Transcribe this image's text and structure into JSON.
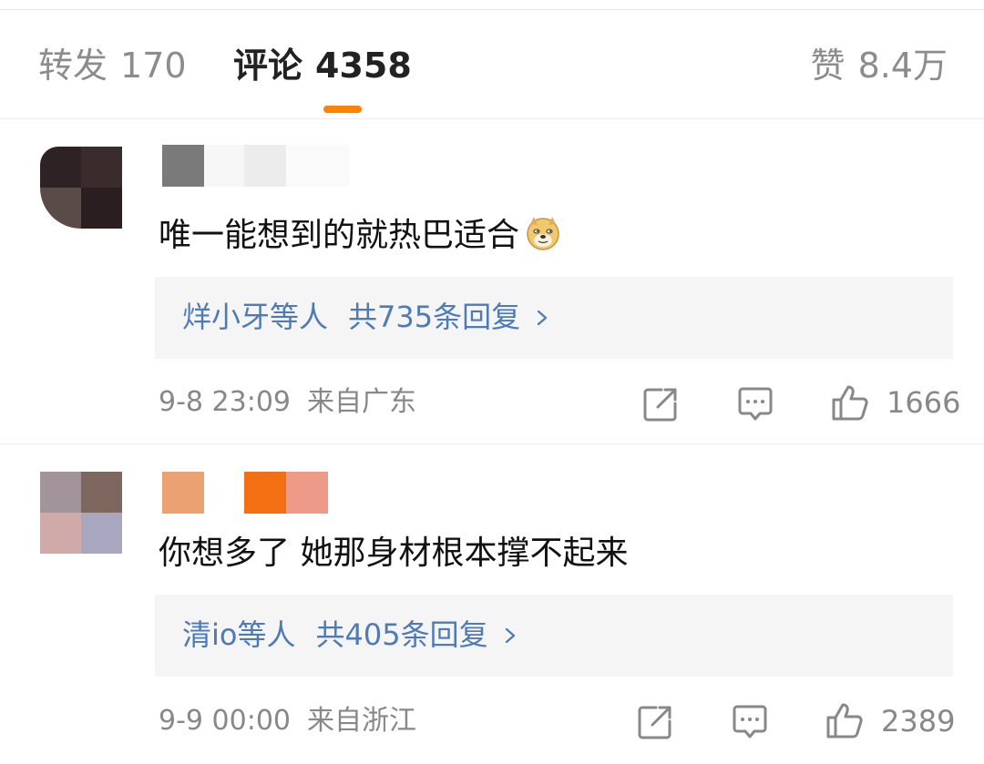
{
  "tabs": {
    "repost": {
      "label": "转发",
      "count": "170"
    },
    "comments": {
      "label": "评论",
      "count": "4358"
    },
    "likes": {
      "label": "赞",
      "count": "8.4万"
    }
  },
  "accent_color": "#ff8200",
  "link_color": "#4e7ab5",
  "comments": [
    {
      "text": "唯一能想到的就热巴适合",
      "emoji": "doge-icon",
      "replies": {
        "users": "烊小牙",
        "suffix": "等人",
        "count_text": "共735条回复"
      },
      "date": "9-8 23:09",
      "location": "来自广东",
      "likes": "1666"
    },
    {
      "text": "你想多了 她那身材根本撑不起来",
      "replies": {
        "users": "清io",
        "suffix": "等人",
        "count_text": "共405条回复"
      },
      "date": "9-9 00:00",
      "location": "来自浙江",
      "likes": "2389"
    }
  ]
}
